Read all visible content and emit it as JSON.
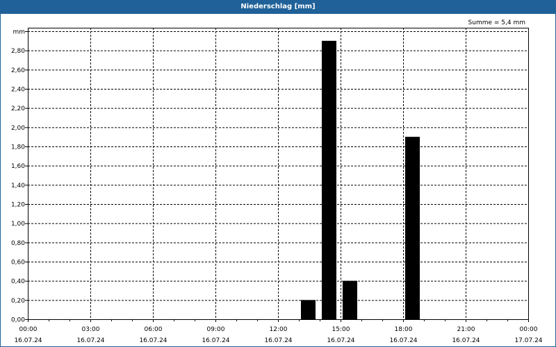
{
  "title": "Niederschlag [mm]",
  "sum_label": "Summe = 5,4 mm",
  "colors": {
    "header": "#1f6198",
    "bar": "#000000"
  },
  "chart_data": {
    "type": "bar",
    "title": "Niederschlag [mm]",
    "ylabel": "mm",
    "ylim": [
      0,
      3.0
    ],
    "yticks": [
      0,
      0.2,
      0.4,
      0.6,
      0.8,
      1.0,
      1.2,
      1.4,
      1.6,
      1.8,
      2.0,
      2.2,
      2.4,
      2.6,
      2.8,
      3.0
    ],
    "ytick_labels": [
      "0,00",
      "0,20",
      "0,40",
      "0,60",
      "0,80",
      "1,00",
      "1,20",
      "1,40",
      "1,60",
      "1,80",
      "2,00",
      "2,20",
      "2,40",
      "2,60",
      "2,80",
      "mm"
    ],
    "xlim_hours": [
      0,
      24
    ],
    "xticks": [
      {
        "hour": 0,
        "time": "00:00",
        "date": "16.07.24"
      },
      {
        "hour": 3,
        "time": "03:00",
        "date": "16.07.24"
      },
      {
        "hour": 6,
        "time": "06:00",
        "date": "16.07.24"
      },
      {
        "hour": 9,
        "time": "09:00",
        "date": "16.07.24"
      },
      {
        "hour": 12,
        "time": "12:00",
        "date": "16.07.24"
      },
      {
        "hour": 15,
        "time": "15:00",
        "date": "16.07.24"
      },
      {
        "hour": 18,
        "time": "18:00",
        "date": "16.07.24"
      },
      {
        "hour": 21,
        "time": "21:00",
        "date": "16.07.24"
      },
      {
        "hour": 24,
        "time": "00:00",
        "date": "17.07.24"
      }
    ],
    "bars": [
      {
        "hour": 13,
        "value": 0.2
      },
      {
        "hour": 14,
        "value": 2.9
      },
      {
        "hour": 15,
        "value": 0.4
      },
      {
        "hour": 18,
        "value": 1.9
      }
    ],
    "grid": true,
    "annotation": "Summe = 5,4 mm"
  }
}
